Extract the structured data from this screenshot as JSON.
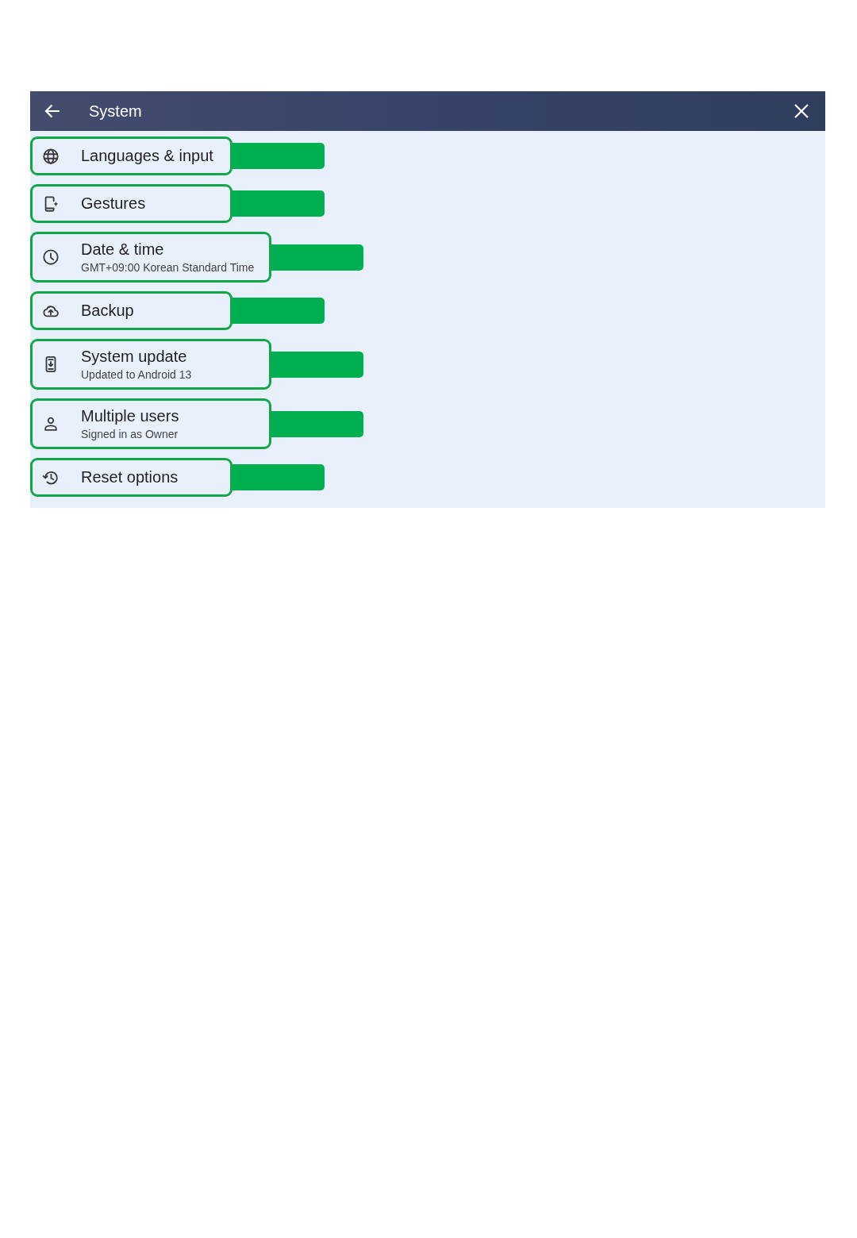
{
  "header": {
    "title": "System"
  },
  "items": [
    {
      "title": "Languages & input",
      "highlighted": true
    },
    {
      "title": "Gestures",
      "highlighted": true
    },
    {
      "title": "Date & time",
      "subtitle": "GMT+09:00 Korean Standard Time",
      "highlighted": true
    },
    {
      "title": "Backup",
      "highlighted": true
    },
    {
      "title": "System update",
      "subtitle": "Updated to Android 13",
      "highlighted": true
    },
    {
      "title": "Multiple users",
      "subtitle": "Signed in as Owner",
      "highlighted": true
    },
    {
      "title": "Reset options",
      "highlighted": true
    }
  ]
}
